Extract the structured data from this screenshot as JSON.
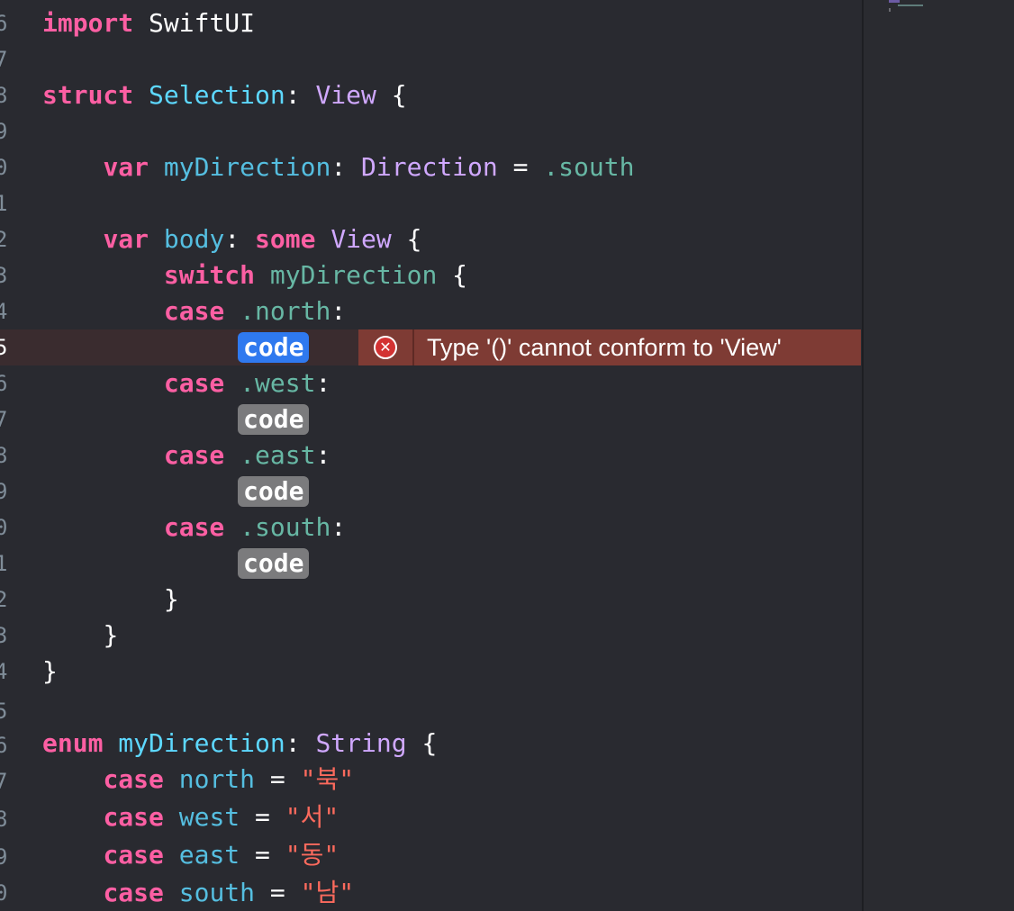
{
  "editor": {
    "current_line": "5",
    "error_message": "Type '()' cannot conform to 'View'",
    "gutter_numbers": [
      "6",
      "7",
      "8",
      "9",
      "0",
      "1",
      "2",
      "3",
      "4",
      "5",
      "6",
      "7",
      "8",
      "9",
      "0",
      "1",
      "2",
      "3",
      "4",
      "5",
      "6",
      "7",
      "8",
      "9",
      "0"
    ]
  },
  "code": {
    "import_kw": "import",
    "import_module": "SwiftUI",
    "struct_kw": "struct",
    "struct_name": "Selection",
    "colon": ":",
    "view_type": "View",
    "open_brace": "{",
    "close_brace": "}",
    "var_kw": "var",
    "my_direction_prop": "myDirection",
    "direction_type": "Direction",
    "equals": "=",
    "south_value": ".south",
    "body_prop": "body",
    "some_kw": "some",
    "switch_kw": "switch",
    "case_kw": "case",
    "north_case": ".north",
    "west_case": ".west",
    "east_case": ".east",
    "south_case": ".south",
    "placeholder": "code",
    "enum_kw": "enum",
    "enum_name": "myDirection",
    "string_type": "String",
    "north_name": "north",
    "west_name": "west",
    "east_name": "east",
    "south_name": "south",
    "north_raw": "\"북\"",
    "west_raw": "\"서\"",
    "east_raw": "\"동\"",
    "south_raw": "\"남\""
  },
  "colors": {
    "background": "#292a30",
    "keyword": "#fc5fa3",
    "type": "#d0a8ff",
    "declaration": "#5dd8ff",
    "other_decl": "#67b7a4",
    "string": "#fc6a5d",
    "error_banner": "#7e3b34",
    "placeholder_active": "#2f79ef",
    "placeholder": "#7b7b7d"
  }
}
